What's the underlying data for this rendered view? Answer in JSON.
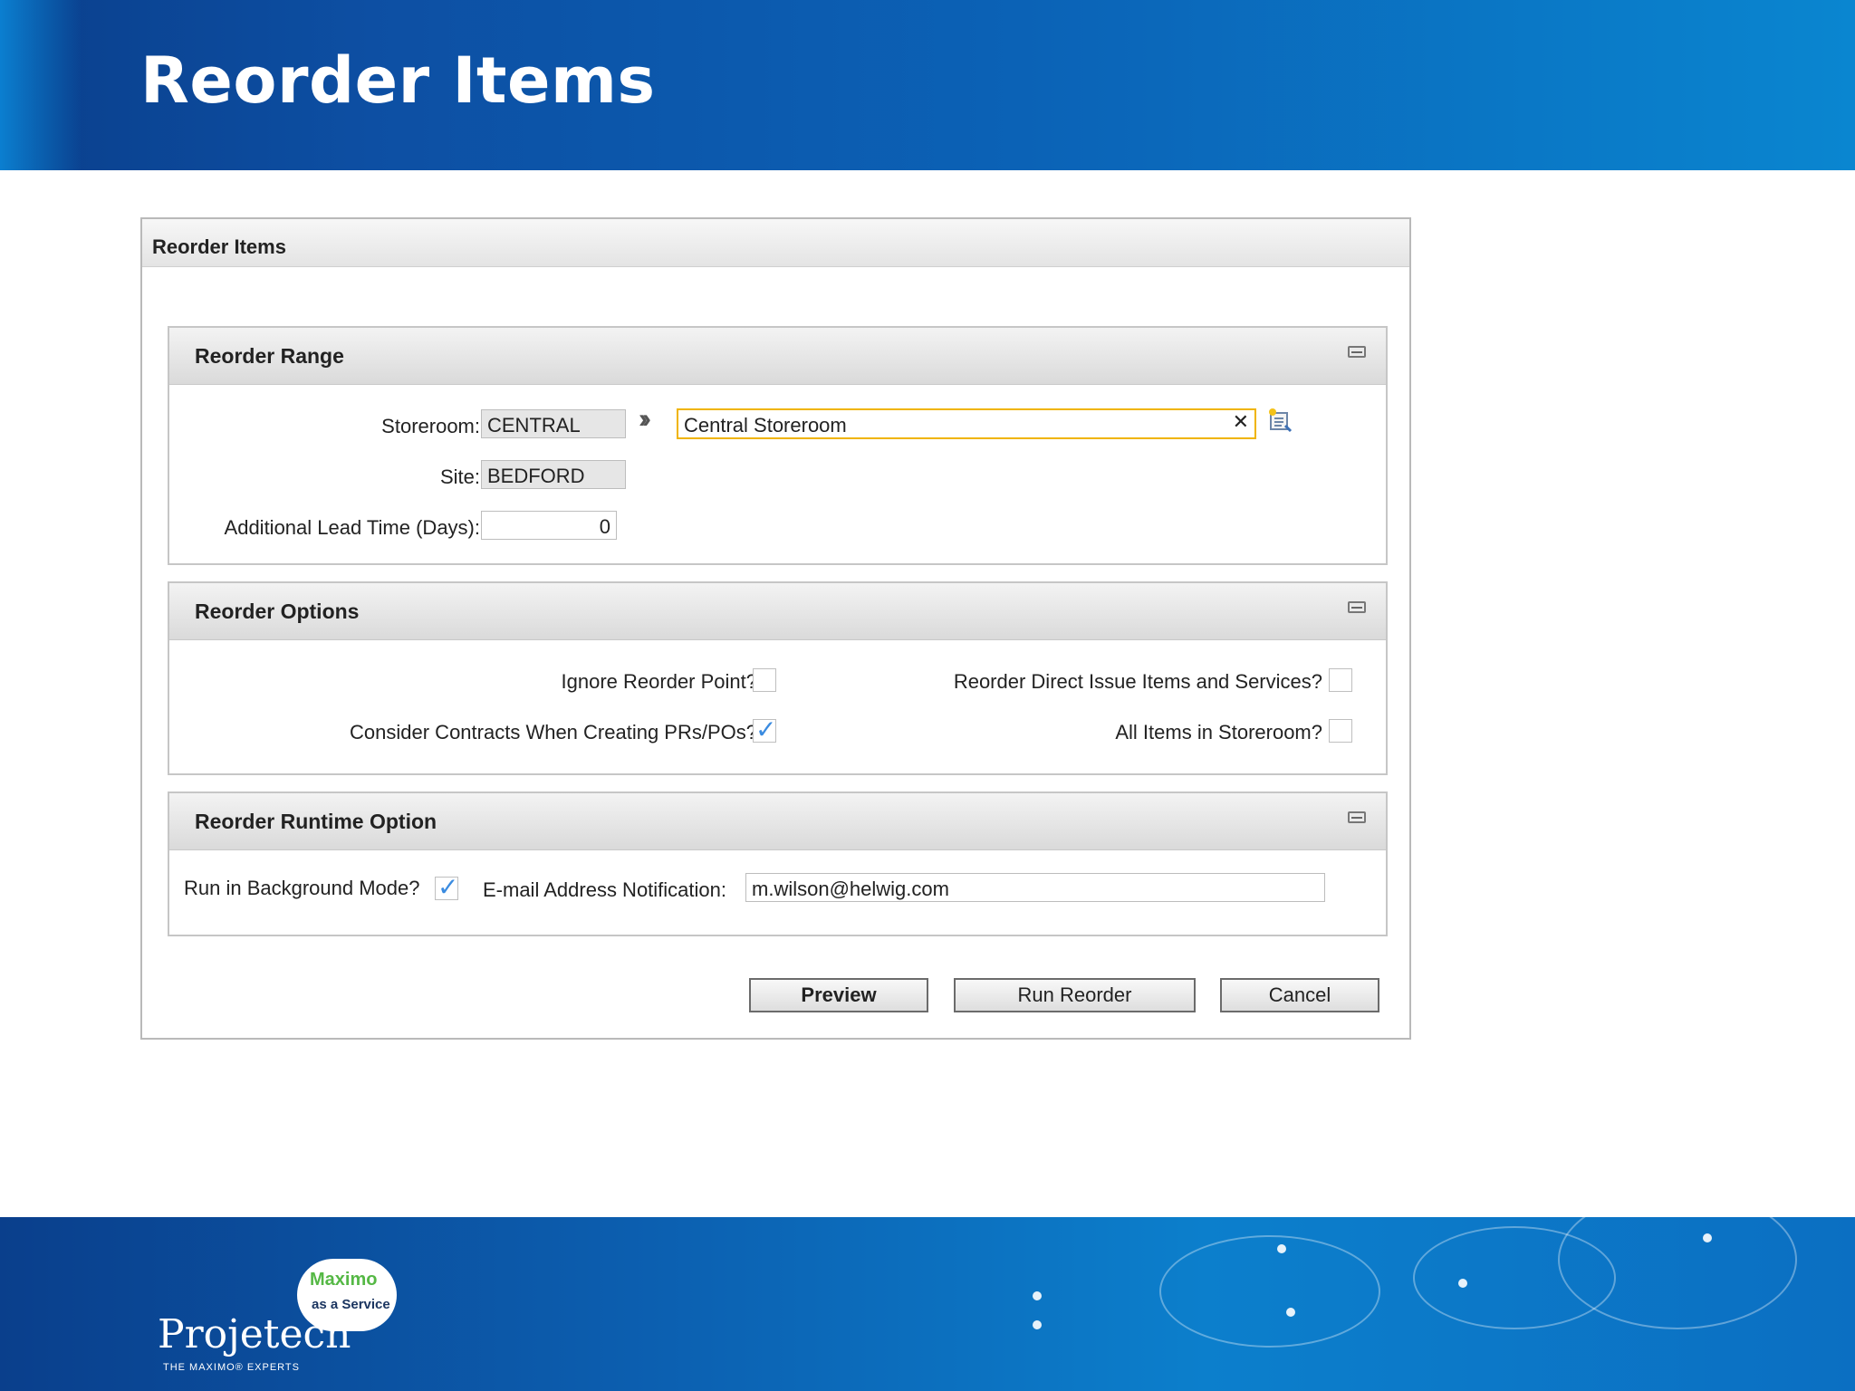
{
  "slide": {
    "title": "Reorder Items"
  },
  "dialog": {
    "title": "Reorder Items",
    "reorder_range": {
      "title": "Reorder Range",
      "storeroom_label": "Storeroom:",
      "storeroom_value": "CENTRAL",
      "storeroom_description": "Central Storeroom",
      "site_label": "Site:",
      "site_value": "BEDFORD",
      "lead_time_label": "Additional Lead Time (Days):",
      "lead_time_value": "0"
    },
    "reorder_options": {
      "title": "Reorder Options",
      "ignore_reorder_point_label": "Ignore Reorder Point?",
      "ignore_reorder_point_checked": false,
      "consider_contracts_label": "Consider Contracts When Creating PRs/POs?",
      "consider_contracts_checked": true,
      "reorder_direct_issue_label": "Reorder Direct Issue Items and Services?",
      "reorder_direct_issue_checked": false,
      "all_items_label": "All Items in Storeroom?",
      "all_items_checked": false
    },
    "reorder_runtime": {
      "title": "Reorder Runtime Option",
      "background_mode_label": "Run in Background Mode?",
      "background_mode_checked": true,
      "email_label": "E-mail Address Notification:",
      "email_value": "m.wilson@helwig.com"
    },
    "buttons": {
      "preview": "Preview",
      "run_reorder": "Run Reorder",
      "cancel": "Cancel"
    }
  },
  "footer": {
    "logo_text": "Projetech",
    "logo_tagline": "THE MAXIMO® EXPERTS",
    "badge_line1": "Maximo",
    "badge_line2": "as a Service"
  },
  "colors": {
    "band_dark": "#0a3f8c",
    "band_light": "#0a86d0",
    "focus_border": "#f0b400",
    "check": "#3a8be0"
  }
}
